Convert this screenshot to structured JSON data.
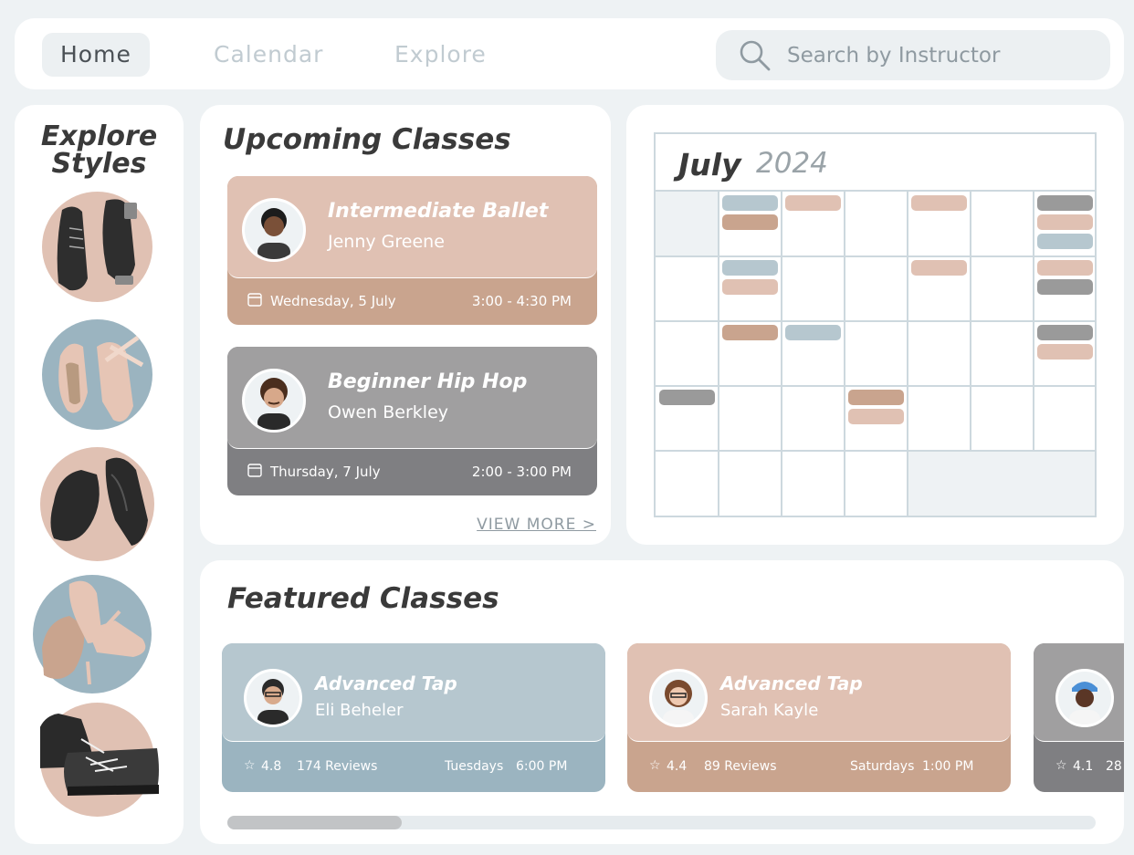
{
  "nav": {
    "tabs": [
      {
        "label": "Home",
        "active": true
      },
      {
        "label": "Calendar",
        "active": false
      },
      {
        "label": "Explore",
        "active": false
      }
    ],
    "search_placeholder": "Search by Instructor"
  },
  "styles": {
    "title_line1": "Explore",
    "title_line2": "Styles",
    "items": [
      {
        "icon": "tap-shoes-icon"
      },
      {
        "icon": "ballet-pointe-shoes-icon"
      },
      {
        "icon": "jazz-shoes-icon"
      },
      {
        "icon": "ballroom-shoes-icon"
      },
      {
        "icon": "hiphop-sneakers-icon"
      }
    ]
  },
  "upcoming": {
    "title": "Upcoming Classes",
    "view_more": "VIEW MORE >",
    "classes": [
      {
        "name": "Intermediate Ballet",
        "instructor": "Jenny Greene",
        "date": "Wednesday, 5 July",
        "time": "3:00 - 4:30 PM",
        "color": "#e0c1b3",
        "bottom_color": "#c9a48e"
      },
      {
        "name": "Beginner Hip Hop",
        "instructor": "Owen Berkley",
        "date": "Thursday, 7 July",
        "time": "2:00 - 3:00 PM",
        "color": "#a09fa0",
        "bottom_color": "#7f7f82"
      }
    ]
  },
  "calendar": {
    "month": "July",
    "year": "2024"
  },
  "featured": {
    "title": "Featured Classes",
    "classes": [
      {
        "name": "Advanced Tap",
        "instructor": "Eli Beheler",
        "rating": "4.8",
        "reviews": "174 Reviews",
        "schedule_day": "Tuesdays",
        "schedule_time": "6:00 PM",
        "color": "#b6c7cf",
        "bottom_color": "#9bb4c0"
      },
      {
        "name": "Advanced Tap",
        "instructor": "Sarah Kayle",
        "rating": "4.4",
        "reviews": "89 Reviews",
        "schedule_day": "Saturdays",
        "schedule_time": "1:00 PM",
        "color": "#e0c1b3",
        "bottom_color": "#c9a48e"
      },
      {
        "name": "",
        "instructor": "",
        "rating": "4.1",
        "reviews": "28",
        "schedule_day": "",
        "schedule_time": "",
        "color": "#a09fa0",
        "bottom_color": "#7f7f82"
      }
    ],
    "scroll_position": 0.2
  },
  "colors": {
    "blue": "#b6c7cf",
    "pink": "#e0c1b3",
    "tan": "#c9a48e",
    "gray": "#a09fa0",
    "darkgray": "#9a9a9a"
  }
}
